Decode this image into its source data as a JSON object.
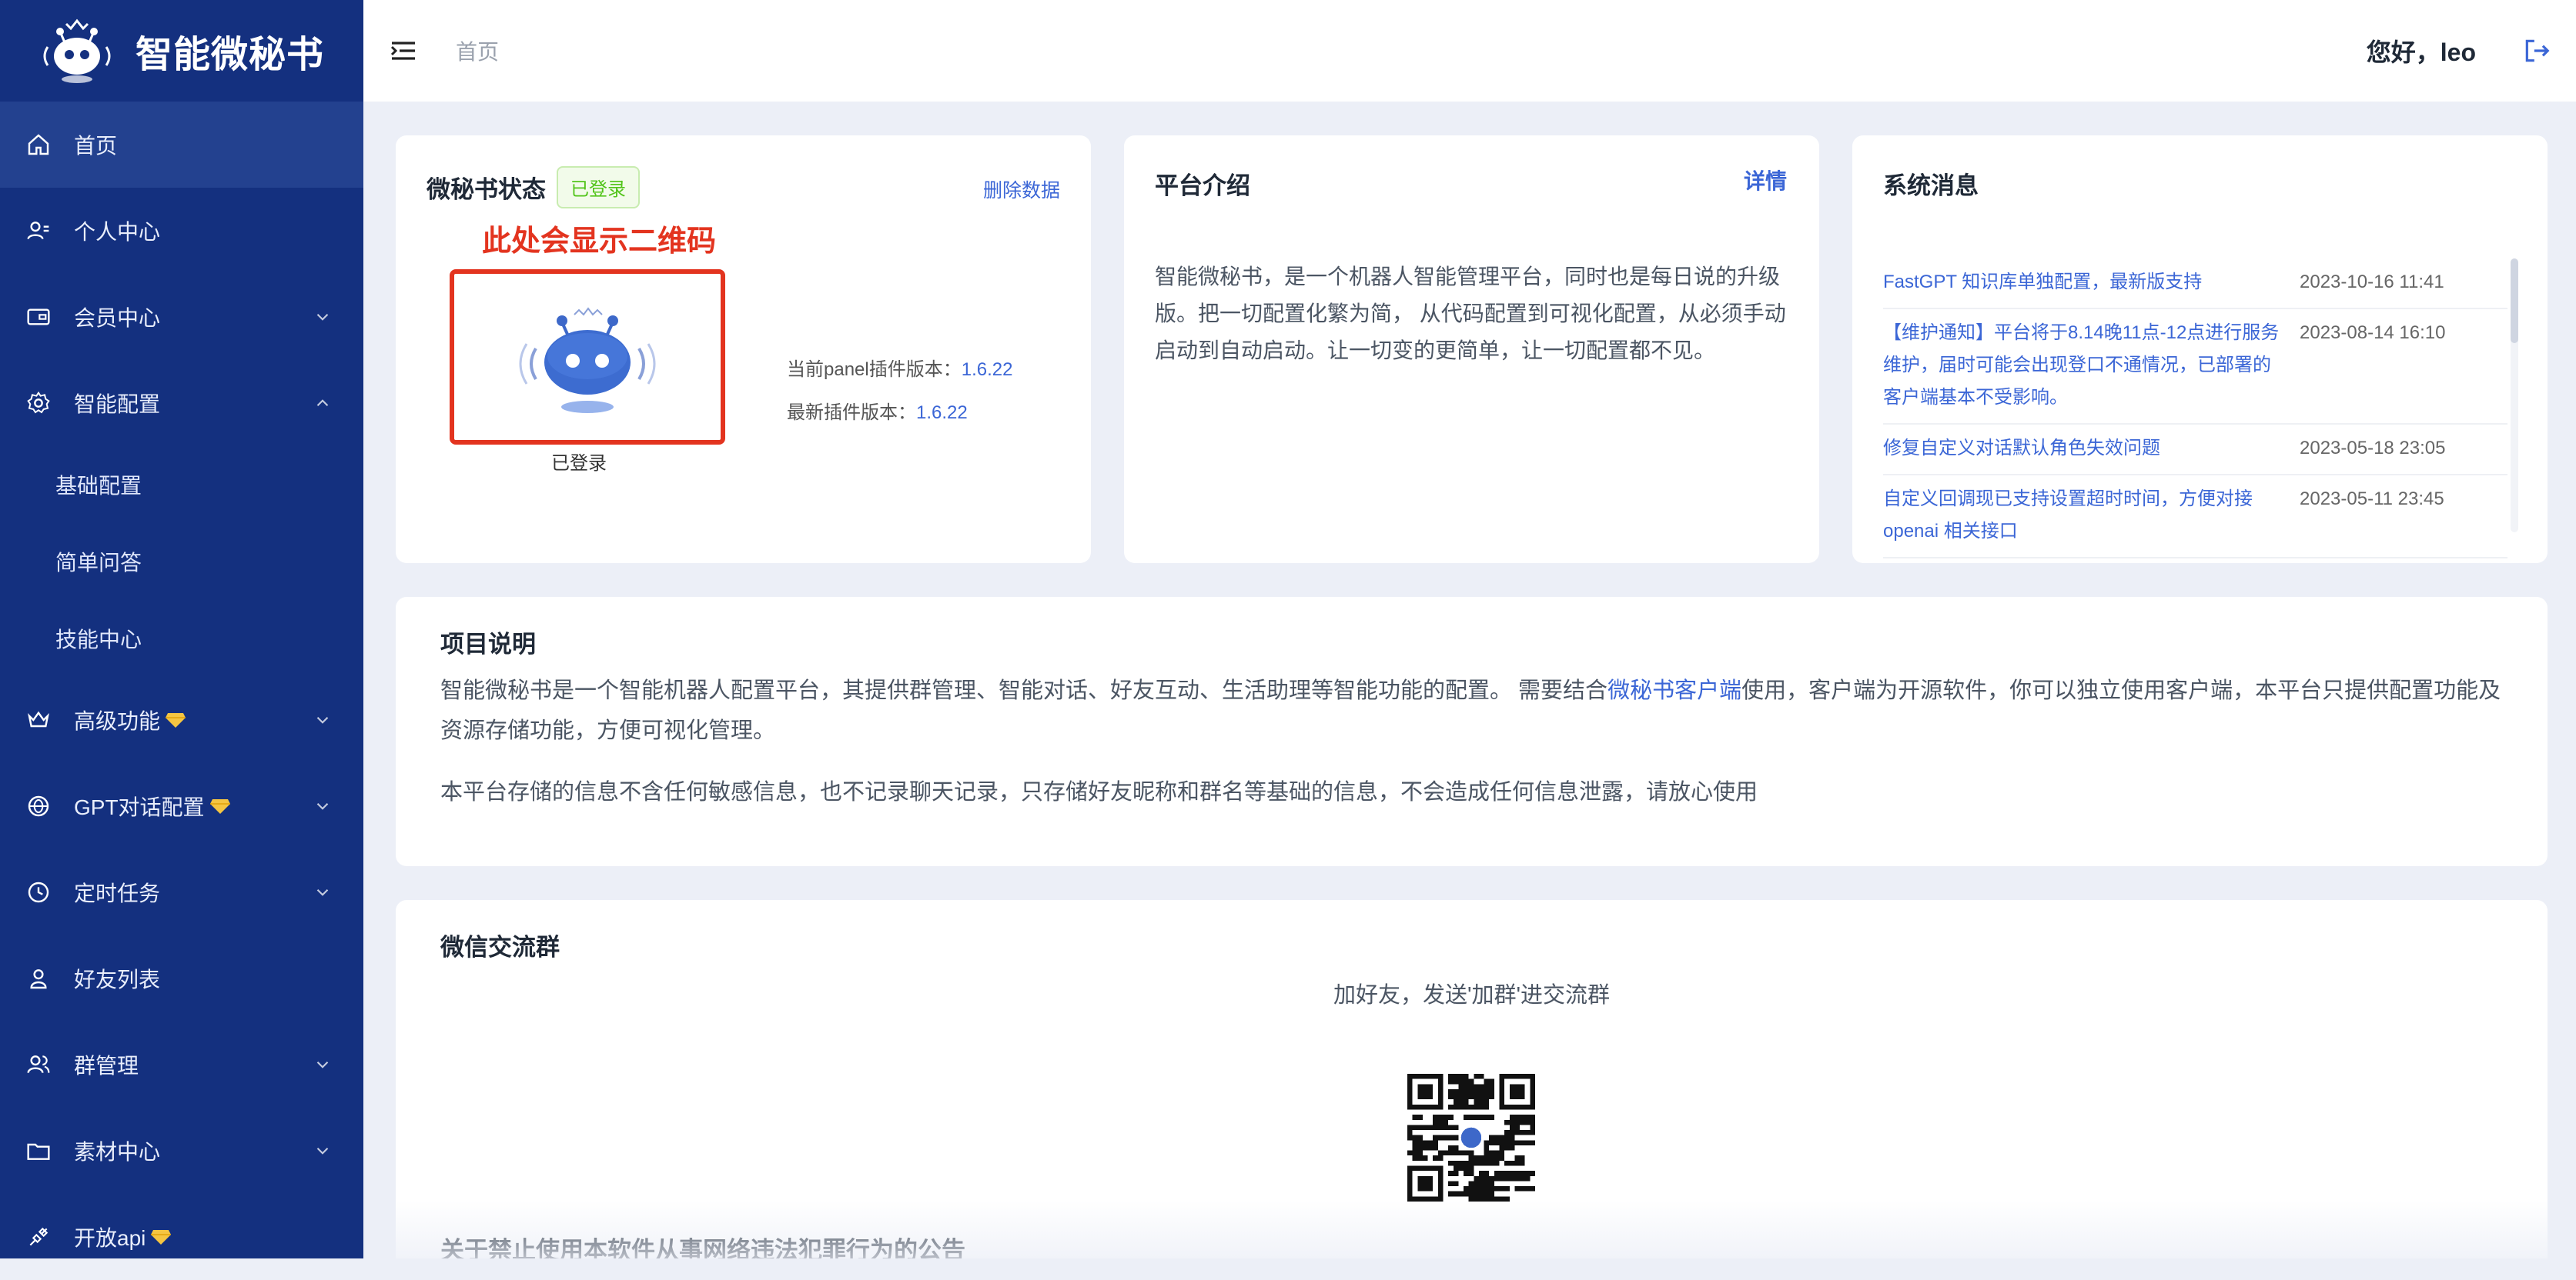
{
  "brand": {
    "name": "智能微秘书"
  },
  "topbar": {
    "breadcrumb": "首页",
    "greeting": "您好，leo"
  },
  "sidebar": {
    "items": [
      {
        "label": "首页",
        "icon": "home-icon",
        "active": true
      },
      {
        "label": "个人中心",
        "icon": "user-card-icon"
      },
      {
        "label": "会员中心",
        "icon": "member-card-icon",
        "chevron": "down"
      },
      {
        "label": "智能配置",
        "icon": "gear-icon",
        "chevron": "up"
      },
      {
        "label": "基础配置",
        "sub": true
      },
      {
        "label": "简单问答",
        "sub": true
      },
      {
        "label": "技能中心",
        "sub": true
      },
      {
        "label": "高级功能",
        "icon": "crown-icon",
        "chevron": "down",
        "gem": true
      },
      {
        "label": "GPT对话配置",
        "icon": "gpt-icon",
        "chevron": "down",
        "gem": true
      },
      {
        "label": "定时任务",
        "icon": "clock-icon",
        "chevron": "down"
      },
      {
        "label": "好友列表",
        "icon": "person-icon"
      },
      {
        "label": "群管理",
        "icon": "group-icon",
        "chevron": "down"
      },
      {
        "label": "素材中心",
        "icon": "folder-icon",
        "chevron": "down"
      },
      {
        "label": "开放api",
        "icon": "api-icon",
        "gem": true
      }
    ]
  },
  "status": {
    "title": "微秘书状态",
    "badge": "已登录",
    "delete": "删除数据",
    "qr_note": "此处会显示二维码",
    "logged_label": "已登录",
    "current_version_label": "当前panel插件版本：",
    "current_version": "1.6.22",
    "latest_version_label": "最新插件版本：",
    "latest_version": "1.6.22"
  },
  "intro": {
    "title": "平台介绍",
    "detail": "详情",
    "body": "智能微秘书，是一个机器人智能管理平台，同时也是每日说的升级版。把一切配置化繁为简， 从代码配置到可视化配置，从必须手动启动到自动启动。让一切变的更简单，让一切配置都不见。"
  },
  "news": {
    "title": "系统消息",
    "items": [
      {
        "text": "FastGPT 知识库单独配置，最新版支持",
        "date": "2023-10-16 11:41"
      },
      {
        "text": "【维护通知】平台将于8.14晚11点-12点进行服务维护，届时可能会出现登口不通情况，已部署的客户端基本不受影响。",
        "date": "2023-08-14 16:10"
      },
      {
        "text": "修复自定义对话默认角色失效问题",
        "date": "2023-05-18 23:05"
      },
      {
        "text": "自定义回调现已支持设置超时时间，方便对接openai 相关接口",
        "date": "2023-05-11 23:45"
      }
    ]
  },
  "project": {
    "title": "项目说明",
    "p1_before": "智能微秘书是一个智能机器人配置平台，其提供群管理、智能对话、好友互动、生活助理等智能功能的配置。 需要结合",
    "p1_link": "微秘书客户端",
    "p1_after": "使用，客户端为开源软件，你可以独立使用客户端，本平台只提供配置功能及资源存储功能，方便可视化管理。",
    "p2": "本平台存储的信息不含任何敏感信息，也不记录聊天记录，只存储好友昵称和群名等基础的信息，不会造成任何信息泄露，请放心使用"
  },
  "wechat": {
    "title": "微信交流群",
    "hint": "加好友，发送'加群'进交流群",
    "notice": "关于禁止使用本软件从事网络违法犯罪行为的公告"
  },
  "colors": {
    "sidebar": "#14307f",
    "accent": "#3b66d6",
    "alert": "#e3341f",
    "success": "#52c41a"
  }
}
